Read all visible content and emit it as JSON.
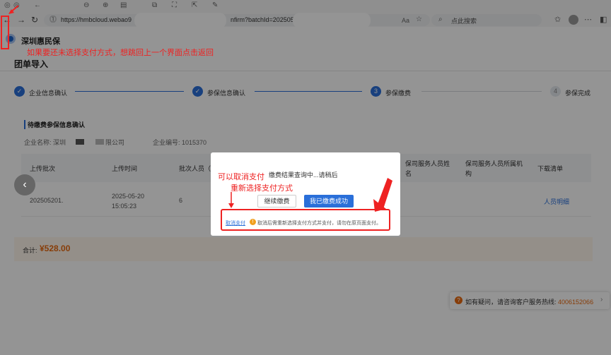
{
  "browser": {
    "url": "https://hmbcloud.webao9",
    "url_tail": "nfirm?batchId=202505",
    "aa_label": "Aa",
    "search_placeholder": "点此搜索"
  },
  "page": {
    "brand_name": "深圳惠民保",
    "title": "团单导入",
    "steps": [
      {
        "num": "✓",
        "label": "企业信息确认"
      },
      {
        "num": "✓",
        "label": "参保信息确认"
      },
      {
        "num": "3",
        "label": "参保缴费"
      },
      {
        "num": "4",
        "label": "参保完成"
      }
    ],
    "section_title": "待缴费参保信息确认",
    "company_label": "企业名称: 深圳",
    "company_suffix": "限公司",
    "company_no": "企业编号: 1015370",
    "table": {
      "headers": [
        "上传批次",
        "上传时间",
        "批次人员（人",
        "保司服务人员姓名",
        "保司服务人员所属机构",
        "下载清单"
      ],
      "row": {
        "batch": "202505201.",
        "time": "2025-05-20 15:05:23",
        "count": "6",
        "download": "人员明细"
      }
    },
    "total_label": "合计:",
    "total_amount": "¥528.00",
    "help_text": "如有疑问，请咨询客户服务热线: ",
    "help_phone": "4006152066"
  },
  "modal": {
    "title": "缴费结果查询中...请稍后",
    "continue_label": "继续缴费",
    "success_label": "我已缴费成功",
    "cancel_label": "取消支付",
    "warn_text": "取消后需重新选择支付方式并支付，请勿在原页面支付。"
  },
  "annotations": {
    "back_note": "如果要还未选择支付方式，想跳回上一个界面点击返回",
    "cancel_note_1": "可以取消支付",
    "cancel_note_2": "重新选择支付方式"
  },
  "colors": {
    "accent": "#2a6fd9",
    "orange": "#e86a10",
    "annotation_red": "#e22"
  }
}
